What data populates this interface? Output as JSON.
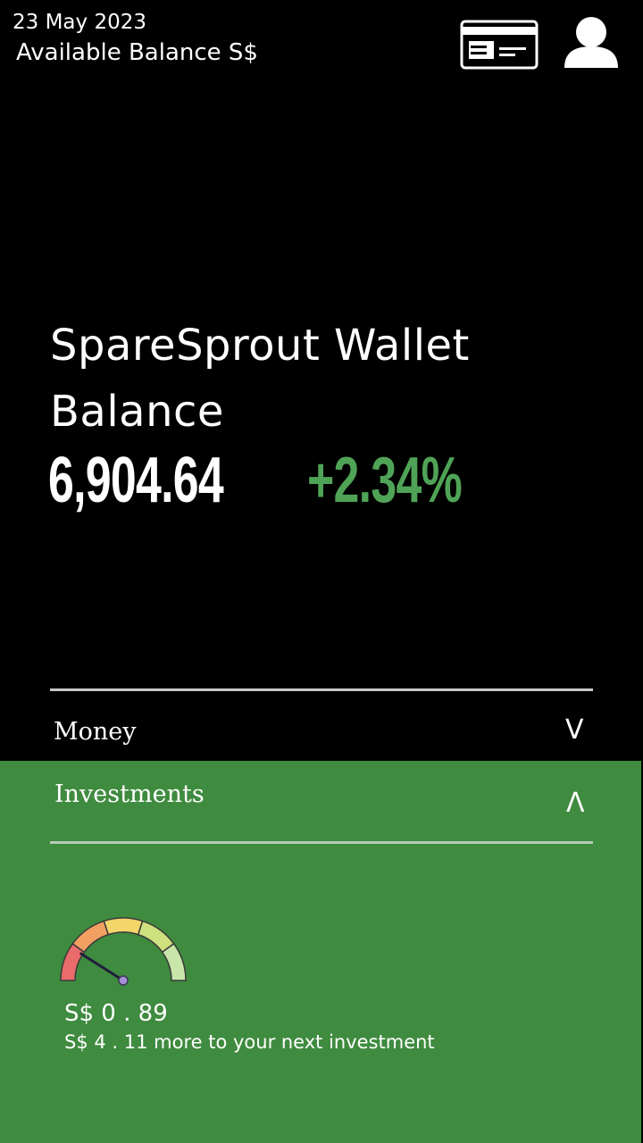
{
  "header": {
    "date": "23 May 2023",
    "available_label": "Available Balance S$",
    "card_icon": "card-icon",
    "profile_icon": "user-icon"
  },
  "wallet": {
    "title": "SpareSprout Wallet Balance",
    "balance": "6,904.64",
    "change": "+2.34%"
  },
  "sections": {
    "money": {
      "label": "Money",
      "chevron": "V"
    },
    "investments": {
      "label": "Investments",
      "chevron": "Λ"
    }
  },
  "investment": {
    "current_amount": "S$ 0 . 89",
    "next_message": "S$ 4 . 11 more to your next investment",
    "gauge_level": 0.18
  },
  "colors": {
    "background": "#000000",
    "accent_green": "#3f8b3f",
    "positive_change": "#4fa356"
  }
}
